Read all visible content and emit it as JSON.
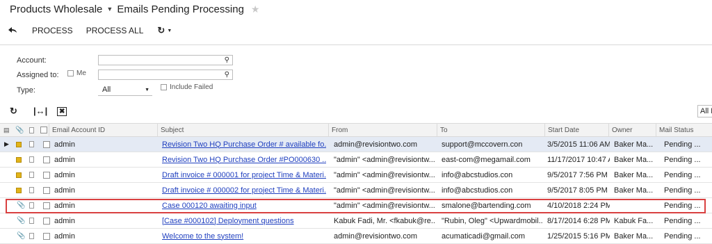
{
  "header": {
    "module": "Products Wholesale",
    "title": "Emails Pending Processing"
  },
  "toolbar": {
    "process": "PROCESS",
    "process_all": "PROCESS ALL"
  },
  "filter": {
    "account_label": "Account:",
    "assigned_label": "Assigned to:",
    "me_label": "Me",
    "type_label": "Type:",
    "type_value": "All",
    "include_failed_label": "Include Failed"
  },
  "grid_toolbar": {
    "all_label": "All R"
  },
  "columns": [
    "Email Account ID",
    "Subject",
    "From",
    "To",
    "Start Date",
    "Owner",
    "Mail Status"
  ],
  "rows": [
    {
      "account": "admin",
      "subject": "Revision Two HQ Purchase Order # available fo...",
      "from": "admin@revisiontwo.com",
      "to": "support@mccovern.con",
      "start": "3/5/2015 11:06 AM",
      "owner": "Baker Ma...",
      "status": "Pending ..."
    },
    {
      "account": "admin",
      "subject": "Revision Two HQ Purchase Order #PO000630 ...",
      "from": "\"admin\" <admin@revisiontw...",
      "to": "east-com@megamail.com",
      "start": "11/17/2017 10:47 A",
      "owner": "Baker Ma...",
      "status": "Pending ..."
    },
    {
      "account": "admin",
      "subject": "Draft invoice # 000001 for project Time & Materi...",
      "from": "\"admin\" <admin@revisiontw...",
      "to": "info@abcstudios.con",
      "start": "9/5/2017 7:56 PM",
      "owner": "Baker Ma...",
      "status": "Pending ..."
    },
    {
      "account": "admin",
      "subject": "Draft invoice # 000002 for project Time & Materi...",
      "from": "\"admin\" <admin@revisiontw...",
      "to": "info@abcstudios.con",
      "start": "9/5/2017 8:05 PM",
      "owner": "Baker Ma...",
      "status": "Pending ..."
    },
    {
      "account": "admin",
      "subject": "Case 000120 awaiting input",
      "from": "\"admin\" <admin@revisiontw...",
      "to": "smalone@bartending.com",
      "start": "4/10/2018 2:24 PM",
      "owner": "",
      "status": "Pending ..."
    },
    {
      "account": "admin",
      "subject": "[Case #000102] Deployment questions",
      "from": "Kabuk Fadi, Mr. <fkabuk@re...",
      "to": "\"Rubin, Oleg\" <Upwardmobil...",
      "start": "8/17/2014 6:28 PM",
      "owner": "Kabuk Fa...",
      "status": "Pending ..."
    },
    {
      "account": "admin",
      "subject": "Welcome to the system!",
      "from": "admin@revisiontwo.com",
      "to": "acumaticadi@gmail.com",
      "start": "1/25/2015 5:16 PM",
      "owner": "Baker Ma...",
      "status": "Pending ..."
    }
  ],
  "colors": {
    "link": "#1f3fbf",
    "highlight": "#d94040",
    "active_row": "#e4eaf4"
  }
}
